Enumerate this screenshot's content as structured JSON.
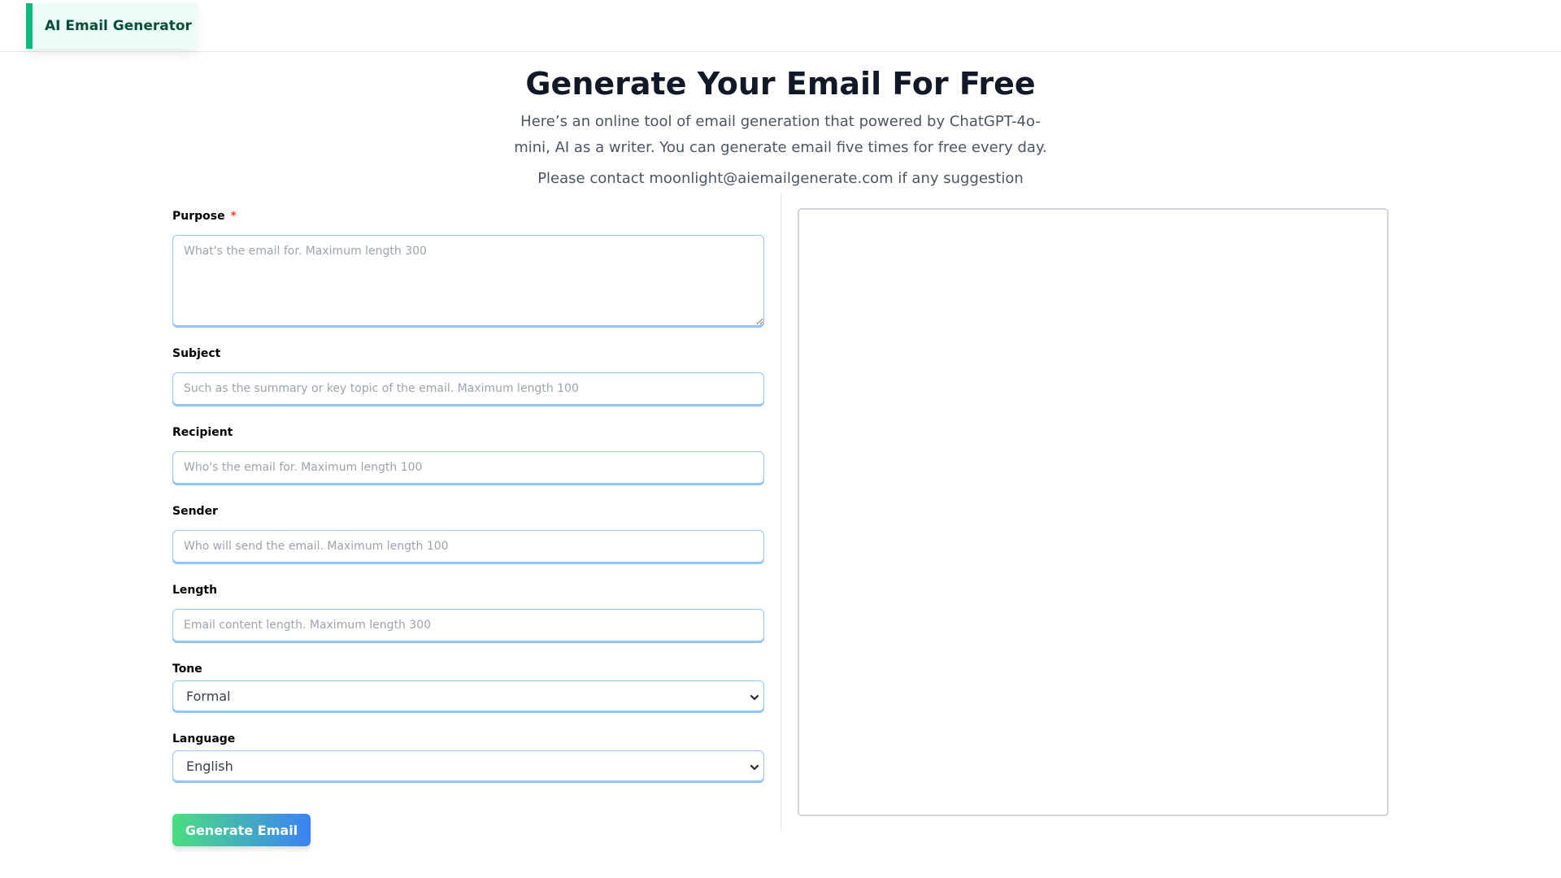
{
  "header": {
    "brand": "AI Email Generator",
    "colors": {
      "accent": "#10b981",
      "brand_bg": "#ecfdf5",
      "brand_text": "#064e3b"
    }
  },
  "hero": {
    "title": "Generate Your Email For Free",
    "description": "Here’s an online tool of email generation that powered by ChatGPT-4o-mini, AI as a writer. You can generate email five times for free every day.",
    "contact": "Please contact moonlight@aiemailgenerate.com if any suggestion"
  },
  "form": {
    "purpose": {
      "label": "Purpose",
      "required_mark": "*",
      "value": "",
      "placeholder": "What's the email for. Maximum length 300"
    },
    "subject": {
      "label": "Subject",
      "value": "",
      "placeholder": "Such as the summary or key topic of the email. Maximum length 100"
    },
    "recipient": {
      "label": "Recipient",
      "value": "",
      "placeholder": "Who's the email for. Maximum length 100"
    },
    "sender": {
      "label": "Sender",
      "value": "",
      "placeholder": "Who will send the email. Maximum length 100"
    },
    "length": {
      "label": "Length",
      "value": "",
      "placeholder": "Email content length. Maximum length 300"
    },
    "tone": {
      "label": "Tone",
      "selected": "Formal"
    },
    "language": {
      "label": "Language",
      "selected": "English"
    },
    "submit_label": "Generate Email",
    "colors": {
      "input_border": "#93c5fd",
      "button_gradient_start": "#4ade80",
      "button_gradient_end": "#3b82f6",
      "required": "#ef4444"
    }
  },
  "output": {
    "content": ""
  }
}
